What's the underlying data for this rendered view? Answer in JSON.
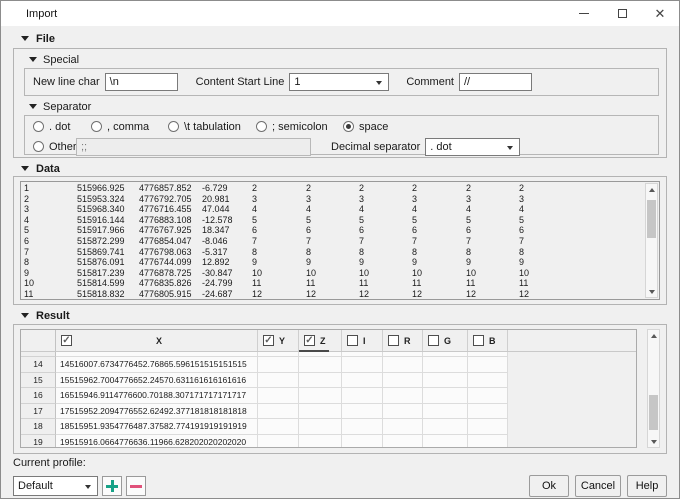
{
  "icons": {
    "collapse": "triangle-down",
    "check": "✓",
    "minimize": "minimize",
    "maximize": "maximize",
    "close": "✕",
    "add_color": "#17a287",
    "remove_color": "#e0517a"
  },
  "window": {
    "title": "Import"
  },
  "file_section": {
    "label": "File",
    "special": {
      "label": "Special",
      "new_line_char": {
        "label": "New line char",
        "value": "\\n"
      },
      "content_start_line": {
        "label": "Content Start Line",
        "value": "1"
      },
      "comment": {
        "label": "Comment",
        "value": "//"
      }
    },
    "separator": {
      "label": "Separator",
      "options": [
        {
          "label": ". dot",
          "selected": false
        },
        {
          "label": ", comma",
          "selected": false
        },
        {
          "label": "\\t tabulation",
          "selected": false
        },
        {
          "label": "; semicolon",
          "selected": false
        },
        {
          "label": "space",
          "selected": true
        }
      ],
      "other": {
        "label": "Other",
        "value": ";;",
        "selected": false
      },
      "decimal_separator": {
        "label": "Decimal separator",
        "value": ". dot"
      }
    }
  },
  "data_section": {
    "label": "Data",
    "rows": [
      [
        "1",
        "515966.925",
        "4776857.852",
        "-6.729",
        "2",
        "2",
        "2",
        "2",
        "2",
        "2"
      ],
      [
        "2",
        "515953.324",
        "4776792.705",
        "20.981",
        "3",
        "3",
        "3",
        "3",
        "3",
        "3"
      ],
      [
        "3",
        "515968.340",
        "4776716.455",
        "47.044",
        "4",
        "4",
        "4",
        "4",
        "4",
        "4"
      ],
      [
        "4",
        "515916.144",
        "4776883.108",
        "-12.578",
        "5",
        "5",
        "5",
        "5",
        "5",
        "5"
      ],
      [
        "5",
        "515917.966",
        "4776767.925",
        "18.347",
        "6",
        "6",
        "6",
        "6",
        "6",
        "6"
      ],
      [
        "6",
        "515872.299",
        "4776854.047",
        "-8.046",
        "7",
        "7",
        "7",
        "7",
        "7",
        "7"
      ],
      [
        "7",
        "515869.741",
        "4776798.063",
        "-5.317",
        "8",
        "8",
        "8",
        "8",
        "8",
        "8"
      ],
      [
        "8",
        "515876.091",
        "4776744.099",
        "12.892",
        "9",
        "9",
        "9",
        "9",
        "9",
        "9"
      ],
      [
        "9",
        "515817.239",
        "4776878.725",
        "-30.847",
        "10",
        "10",
        "10",
        "10",
        "10",
        "10"
      ],
      [
        "10",
        "515814.599",
        "4776835.826",
        "-24.799",
        "11",
        "11",
        "11",
        "11",
        "11",
        "11"
      ],
      [
        "11",
        "515818.832",
        "4776805.915",
        "-24.687",
        "12",
        "12",
        "12",
        "12",
        "12",
        "12"
      ]
    ]
  },
  "result_section": {
    "label": "Result",
    "columns": [
      {
        "label": "X",
        "checked": true
      },
      {
        "label": "Y",
        "checked": true
      },
      {
        "label": "Z",
        "checked": true
      },
      {
        "label": "I",
        "checked": false
      },
      {
        "label": "R",
        "checked": false
      },
      {
        "label": "G",
        "checked": false
      },
      {
        "label": "B",
        "checked": false
      }
    ],
    "rows": [
      {
        "num": "14",
        "x": "14516007.6734776452.76865.596151515151515"
      },
      {
        "num": "15",
        "x": "15515962.7004776652.24570.631161616161616"
      },
      {
        "num": "16",
        "x": "16515946.9114776600.70188.307171717171717"
      },
      {
        "num": "17",
        "x": "17515952.2094776552.62492.377181818181818"
      },
      {
        "num": "18",
        "x": "18515951.9354776487.37582.774191919191919"
      },
      {
        "num": "19",
        "x": "19515916.0664776636.11966.628202020202020"
      }
    ]
  },
  "footer": {
    "current_profile_label": "Current profile:",
    "profile_value": "Default",
    "ok_label": "Ok",
    "cancel_label": "Cancel",
    "help_label": "Help"
  }
}
